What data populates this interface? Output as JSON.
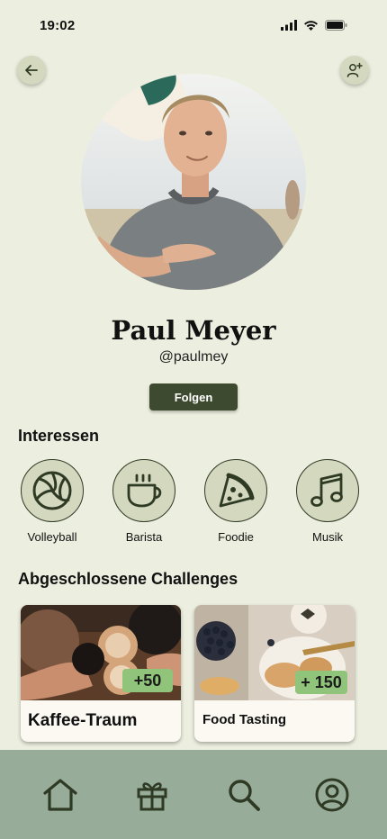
{
  "status_bar": {
    "time": "19:02"
  },
  "profile": {
    "name": "Paul Meyer",
    "handle": "@paulmey",
    "follow_label": "Folgen"
  },
  "icons": {
    "back": "arrow-left-icon",
    "add_user": "add-user-icon"
  },
  "interests": {
    "title": "Interessen",
    "items": [
      {
        "label": "Volleyball",
        "icon": "volleyball-icon"
      },
      {
        "label": "Barista",
        "icon": "coffee-cup-icon"
      },
      {
        "label": "Foodie",
        "icon": "pizza-icon"
      },
      {
        "label": "Musik",
        "icon": "music-note-icon"
      }
    ]
  },
  "challenges": {
    "title": "Abgeschlossene Challenges",
    "items": [
      {
        "title": "Kaffee-Traum",
        "points": "+50"
      },
      {
        "title": "Food Tasting",
        "points": "+ 150"
      }
    ]
  },
  "bottom_nav": {
    "items": [
      {
        "icon": "home-icon"
      },
      {
        "icon": "gift-icon"
      },
      {
        "icon": "search-icon"
      },
      {
        "icon": "profile-icon"
      }
    ]
  },
  "colors": {
    "background": "#eceedf",
    "accent": "#3e4a2f",
    "badge": "#8fc47a",
    "nav": "#97ad99"
  }
}
